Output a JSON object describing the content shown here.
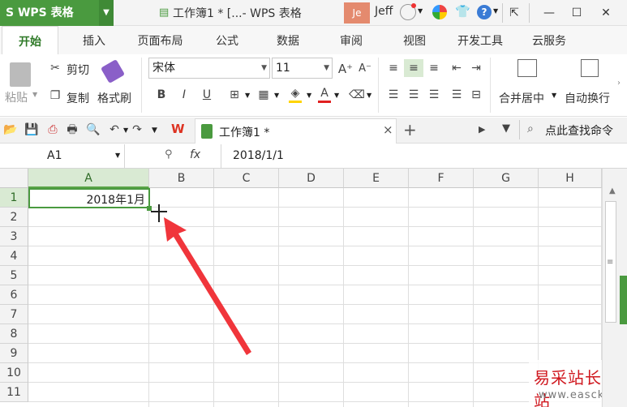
{
  "titlebar": {
    "app_name": "S WPS 表格",
    "doc_title": "工作簿1 * [...- WPS 表格",
    "user_initials": "Je",
    "user_name": "Jeff"
  },
  "ribbon_tabs": [
    "开始",
    "插入",
    "页面布局",
    "公式",
    "数据",
    "审阅",
    "视图",
    "开发工具",
    "云服务"
  ],
  "ribbon": {
    "paste": "粘贴",
    "cut": "剪切",
    "copy": "复制",
    "format_painter": "格式刷",
    "font_name": "宋体",
    "font_size": "11",
    "bold": "B",
    "italic": "I",
    "underline": "U",
    "merge_center": "合并居中",
    "wrap_text": "自动换行"
  },
  "doc_tab": {
    "label": "工作簿1 *",
    "close": "×",
    "add": "+"
  },
  "search": {
    "label": "点此查找命令"
  },
  "formula_bar": {
    "name_box": "A1",
    "fx": "fx",
    "value": "2018/1/1"
  },
  "sheet": {
    "columns": [
      "A",
      "B",
      "C",
      "D",
      "E",
      "F",
      "G",
      "H"
    ],
    "rows": [
      "1",
      "2",
      "3",
      "4",
      "5",
      "6",
      "7",
      "8",
      "9",
      "10",
      "11"
    ],
    "selected_cell": "A1",
    "cell_a1": "2018年1月"
  },
  "watermark": {
    "site_name": "易采站长站",
    "url": "www.easck.com"
  },
  "colors": {
    "brand_green": "#4a9a3f",
    "selection_green": "#5aa447",
    "arrow_red": "#f0353b"
  }
}
